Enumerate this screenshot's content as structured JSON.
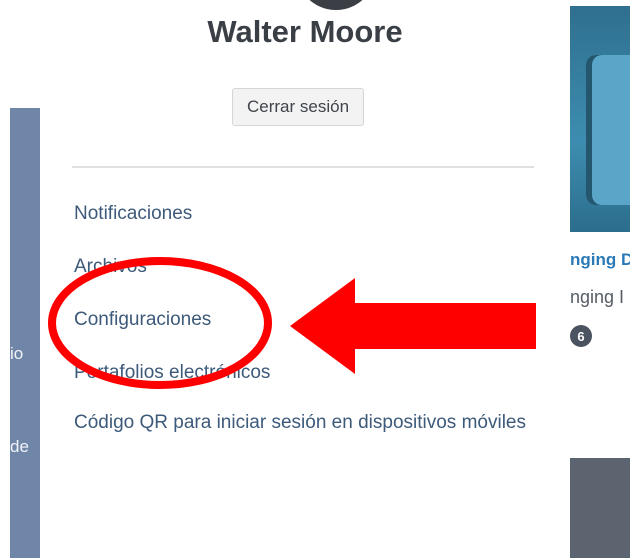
{
  "user": {
    "name": "Walter Moore"
  },
  "dropdown": {
    "logout_label": "Cerrar sesión",
    "items": [
      {
        "label": "Notificaciones"
      },
      {
        "label": "Archivos"
      },
      {
        "label": "Configuraciones"
      },
      {
        "label": "Portafolios electrónicos"
      },
      {
        "label": "Código QR para iniciar sesión en dispositivos móviles"
      }
    ]
  },
  "background": {
    "left_fragments": [
      "io",
      "de"
    ],
    "card": {
      "title": "nging D",
      "subtitle": "nging I",
      "badge": "6"
    }
  },
  "annotation": {
    "circle_color": "#ff0000",
    "arrow_color": "#ff0000"
  }
}
